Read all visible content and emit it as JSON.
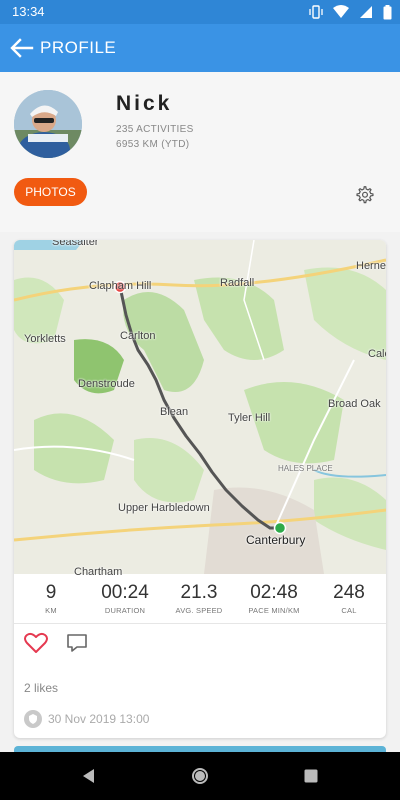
{
  "status_bar": {
    "time": "13:34"
  },
  "app_bar": {
    "title": "PROFILE"
  },
  "profile": {
    "name": "Nick",
    "activities": "235 ACTIVITIES",
    "distance_ytd": "6953 KM (YTD)",
    "photos_label": "PHOTOS"
  },
  "activity": {
    "map_labels": {
      "seasalter": "Seasalter",
      "clapham_hill": "Clapham Hill",
      "radfall": "Radfall",
      "herne": "Herne",
      "yorkletts": "Yorkletts",
      "carlton": "Carlton",
      "calc": "Calc",
      "denstroude": "Denstroude",
      "blean": "Blean",
      "tyler_hill": "Tyler Hill",
      "broad_oak": "Broad Oak",
      "hales_place": "HALES PLACE",
      "upper_harbledown": "Upper Harbledown",
      "canterbury": "Canterbury",
      "chartham": "Chartham"
    },
    "stats": [
      {
        "value": "9",
        "label": "KM"
      },
      {
        "value": "00:24",
        "label": "DURATION"
      },
      {
        "value": "21.3",
        "label": "AVG. SPEED"
      },
      {
        "value": "02:48",
        "label": "PACE MIN/KM"
      },
      {
        "value": "248",
        "label": "CAL"
      }
    ],
    "likes": "2 likes",
    "date": "30 Nov 2019 13:00"
  },
  "colors": {
    "app_bar": "#3a93e5",
    "status_bar": "#2f86d6",
    "photos_button": "#f15a11",
    "route": "#555555",
    "start_marker": "#e53935",
    "end_marker": "#2eaa4a",
    "heart": "#e53950"
  },
  "icons": {
    "back": "arrow-left-icon",
    "settings": "gear-icon",
    "like": "heart-icon",
    "comment": "comment-icon",
    "date": "shield-icon"
  }
}
